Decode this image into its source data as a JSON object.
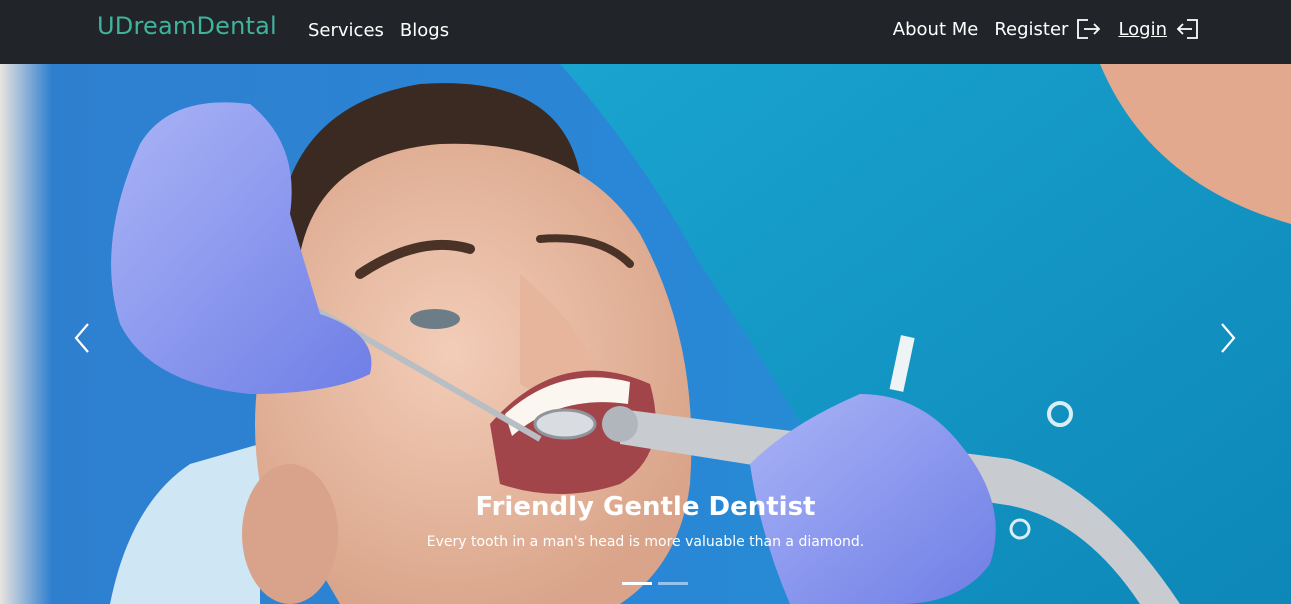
{
  "navbar": {
    "brand": "UDreamDental",
    "left_links": [
      "Services",
      "Blogs"
    ],
    "right_links": {
      "about": "About Me",
      "register": "Register",
      "login": "Login"
    },
    "brand_color": "#3fb39b",
    "background": "#212529"
  },
  "carousel": {
    "slide_title": "Friendly Gentle Dentist",
    "slide_text": "Every tooth in a man's head is more valuable than a diamond.",
    "slide_count": 2,
    "active_slide": 1,
    "controls": {
      "prev_icon": "chevron-left-icon",
      "next_icon": "chevron-right-icon"
    }
  },
  "icons": {
    "register": "sign-out-arrow-icon",
    "login": "sign-in-arrow-icon"
  }
}
